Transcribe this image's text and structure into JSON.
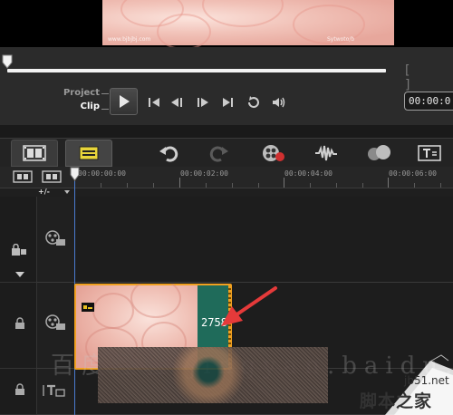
{
  "preview": {
    "watermark_left": "www.bjbjbj.com",
    "watermark_right": "Sytwoto/b"
  },
  "transport": {
    "mode_project": "Project",
    "mode_clip": "Clip",
    "timecode": "00:00:0",
    "brackets": "[ ]",
    "progress": 0
  },
  "toolbar": {
    "tools": [
      "storyboard-view",
      "timeline-view",
      "undo",
      "redo",
      "record-capture",
      "sound-mixer",
      "auto-music",
      "title"
    ]
  },
  "ruler": {
    "labels": [
      "00:00:00:00",
      "00:00:02:00",
      "00:00:04:00",
      "00:00:06:00"
    ]
  },
  "timeline": {
    "zoom_label": "+/-"
  },
  "clip": {
    "label": "2758"
  },
  "watermark": {
    "script": "百度经验 jingyan.baidu.com",
    "site": "jb51.net",
    "brand": "脚本之家"
  },
  "colors": {
    "accent_clip": "#f0a020",
    "playhead": "#4a7bd0",
    "arrow": "#e53a3a",
    "panel": "#2b2b2b"
  }
}
